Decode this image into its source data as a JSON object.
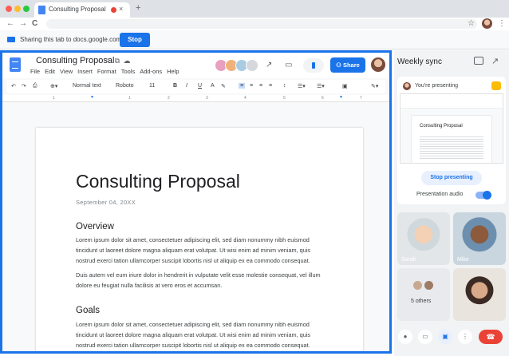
{
  "browser": {
    "tab_title": "Consulting Proposal",
    "close_glyph": "×",
    "new_tab_glyph": "+",
    "nav": {
      "back": "←",
      "forward": "→",
      "reload": "C"
    },
    "star_glyph": "☆",
    "menu_glyph": "⋮"
  },
  "share_bar": {
    "text": "Sharing this tab to docs.google.com",
    "stop_label": "Stop"
  },
  "doc": {
    "title": "Consulting Proposal",
    "title_icons": "☆ ⧉ ☁",
    "menu": [
      "File",
      "Edit",
      "View",
      "Insert",
      "Format",
      "Tools",
      "Add-ons",
      "Help"
    ],
    "share_label": "Share",
    "toolbar": {
      "style": "Normal text",
      "font": "Roboto",
      "size": "11"
    },
    "ruler_marks": [
      "1",
      "1",
      "2",
      "3",
      "4",
      "5",
      "6",
      "7"
    ],
    "heading": "Consulting Proposal",
    "date": "September 04, 20XX",
    "section1": "Overview",
    "para1": "Lorem ipsum dolor sit amet, consectetuer adipiscing elit, sed diam nonummy nibh euismod tincidunt ut laoreet dolore magna aliquam erat volutpat. Ut wisi enim ad minim veniam, quis nostrud exerci tation ullamcorper suscipit lobortis nisl ut aliquip ex ea commodo consequat.",
    "para2": "Duis autem vel eum iriure dolor in hendrerit in vulputate velit esse molestie consequat, vel illum dolore eu feugiat nulla facilisis at vero eros et accumsan.",
    "section2": "Goals",
    "para3": "Lorem ipsum dolor sit amet, consectetuer adipiscing elit, sed diam nonummy nibh euismod tincidunt ut laoreet dolore magna aliquam erat volutpat. Ut wisi enim ad minim veniam, quis nostrud exerci tation ullamcorper suscipit lobortis nisl ut aliquip ex ea commodo consequat."
  },
  "meet": {
    "title": "Weekly sync",
    "presenting_text": "You're presenting",
    "stop_presenting": "Stop presenting",
    "audio_label": "Presentation audio",
    "participants": [
      {
        "name": "Sarah"
      },
      {
        "name": "Mike"
      }
    ],
    "others": "5 others",
    "colors": {
      "accent": "#1a73e8",
      "end_call": "#ea4335"
    }
  }
}
